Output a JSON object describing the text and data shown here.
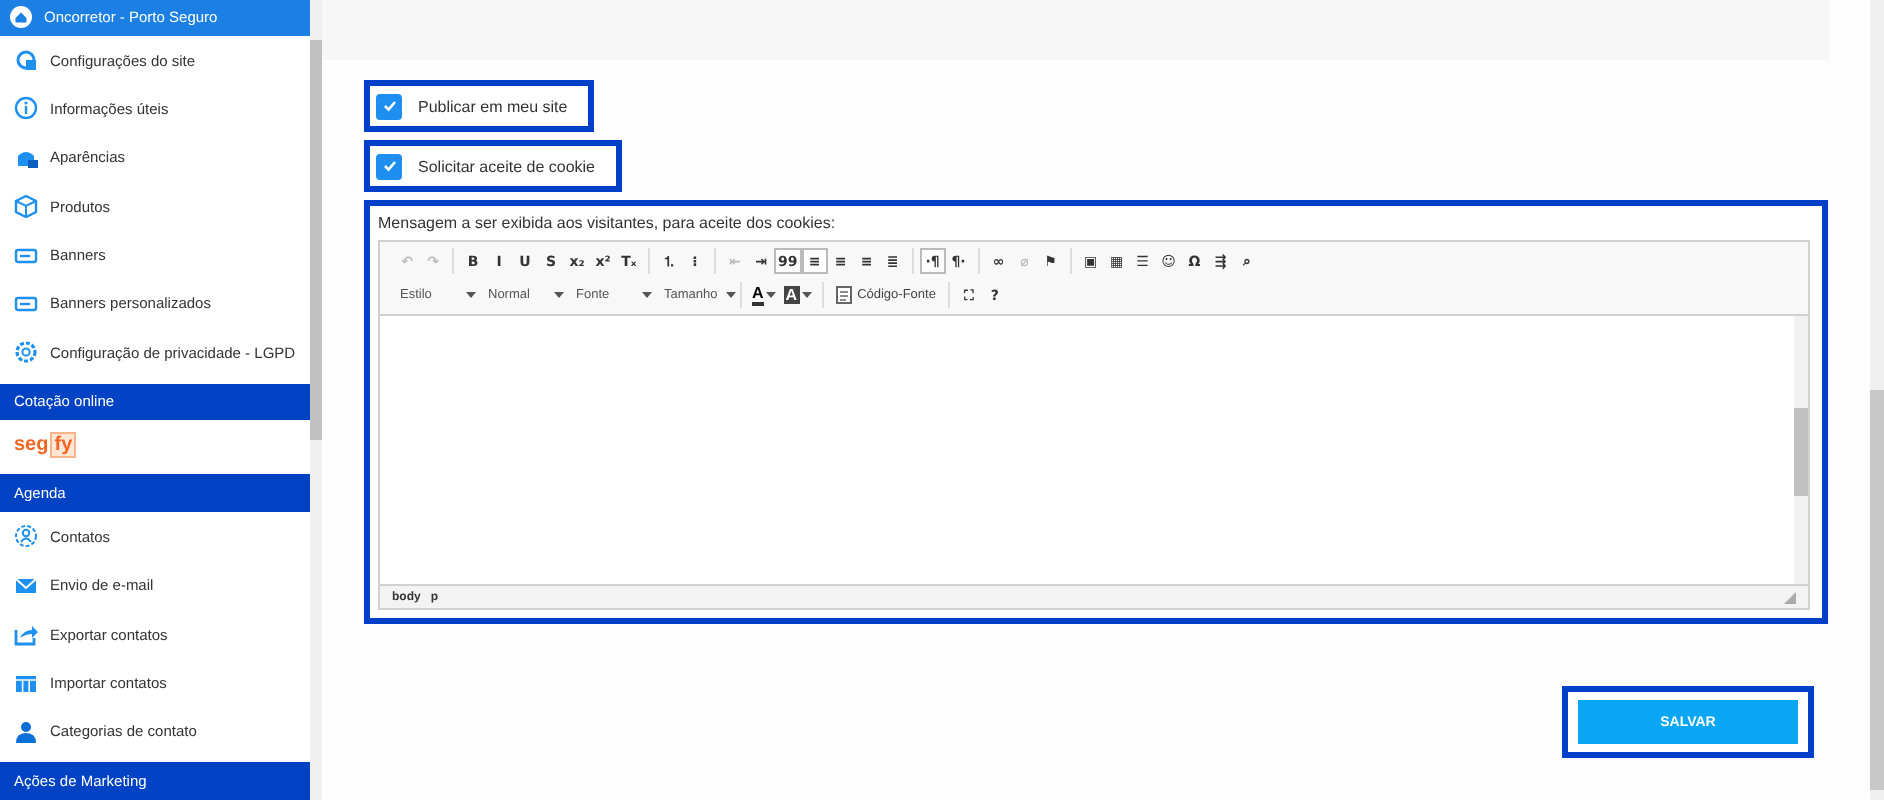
{
  "sidebar": {
    "items": [
      {
        "kind": "header",
        "label": "Oncorretor - Porto Seguro"
      },
      {
        "kind": "item",
        "label": "Configurações do site"
      },
      {
        "kind": "item",
        "label": "Informações úteis"
      },
      {
        "kind": "item",
        "label": "Aparências"
      },
      {
        "kind": "item",
        "label": "Produtos"
      },
      {
        "kind": "item",
        "label": "Banners"
      },
      {
        "kind": "item",
        "label": "Banners personalizados"
      },
      {
        "kind": "item",
        "label": "Configuração de privacidade - LGPD"
      },
      {
        "kind": "section",
        "label": "Cotação online"
      },
      {
        "kind": "logo",
        "parts": [
          "seg",
          "fy"
        ]
      },
      {
        "kind": "section",
        "label": "Agenda"
      },
      {
        "kind": "item",
        "label": "Contatos"
      },
      {
        "kind": "item",
        "label": "Envio de e-mail"
      },
      {
        "kind": "item",
        "label": "Exportar contatos"
      },
      {
        "kind": "item",
        "label": "Importar contatos"
      },
      {
        "kind": "item",
        "label": "Categorias de contato"
      },
      {
        "kind": "section",
        "label": "Ações de Marketing"
      }
    ]
  },
  "options": [
    {
      "label": "Publicar em meu site",
      "checked": true
    },
    {
      "label": "Solicitar aceite de cookie",
      "checked": true
    }
  ],
  "editor": {
    "label": "Mensagem a ser exibida aos visitantes, para aceite dos cookies:",
    "toolbar_row_1": [
      [
        {
          "label": "↶",
          "disabled": true,
          "pressed": false
        },
        {
          "label": "↷",
          "disabled": true,
          "pressed": false
        }
      ],
      [
        {
          "label": "B",
          "disabled": false,
          "pressed": false
        },
        {
          "label": "I",
          "disabled": false,
          "pressed": false
        },
        {
          "label": "U",
          "disabled": false,
          "pressed": false
        },
        {
          "label": "S",
          "disabled": false,
          "pressed": false
        },
        {
          "label": "x₂",
          "disabled": false,
          "pressed": false
        },
        {
          "label": "x²",
          "disabled": false,
          "pressed": false
        },
        {
          "label": "Tₓ",
          "disabled": false,
          "pressed": false
        }
      ],
      [
        {
          "label": "⒈",
          "disabled": false,
          "pressed": false
        },
        {
          "label": "⁝",
          "disabled": false,
          "pressed": false
        }
      ],
      [
        {
          "label": "⇤",
          "disabled": true,
          "pressed": false
        },
        {
          "label": "⇥",
          "disabled": false,
          "pressed": false
        },
        {
          "label": "99",
          "disabled": false,
          "pressed": true
        },
        {
          "label": "≡",
          "disabled": false,
          "pressed": true
        },
        {
          "label": "≡",
          "disabled": false,
          "pressed": false
        },
        {
          "label": "≡",
          "disabled": false,
          "pressed": false
        },
        {
          "label": "≣",
          "disabled": false,
          "pressed": false
        }
      ],
      [
        {
          "label": "·¶",
          "disabled": false,
          "pressed": true
        },
        {
          "label": "¶·",
          "disabled": false,
          "pressed": false
        }
      ],
      [
        {
          "label": "∞",
          "disabled": false,
          "pressed": false
        },
        {
          "label": "⌀",
          "disabled": true,
          "pressed": false
        },
        {
          "label": "⚑",
          "disabled": false,
          "pressed": false
        }
      ],
      [
        {
          "label": "▣",
          "disabled": false,
          "pressed": false
        },
        {
          "label": "▦",
          "disabled": false,
          "pressed": false
        },
        {
          "label": "☰",
          "disabled": false,
          "pressed": false
        },
        {
          "label": "☺",
          "disabled": false,
          "pressed": false
        },
        {
          "label": "Ω",
          "disabled": false,
          "pressed": false
        },
        {
          "label": "⇶",
          "disabled": false,
          "pressed": false
        },
        {
          "label": "⌕",
          "disabled": false,
          "pressed": false
        }
      ]
    ],
    "dropdowns": [
      "Estilo",
      "Normal",
      "Fonte",
      "Tamanho"
    ],
    "color_buttons": [
      "A",
      "A"
    ],
    "source_button": "Código-Fonte",
    "extra_buttons": [
      "⛶",
      "?"
    ],
    "path": [
      "body",
      "p"
    ]
  },
  "save_button": "SALVAR"
}
